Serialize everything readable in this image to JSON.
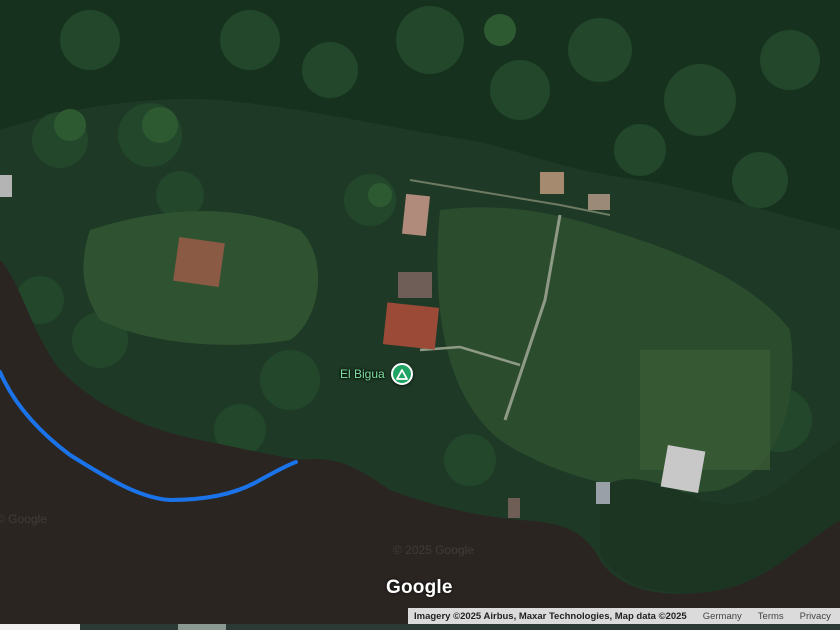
{
  "map": {
    "type": "satellite",
    "place": {
      "name": "El Bigua",
      "icon": "campground-pin-icon",
      "pin_color": "#1fa463"
    },
    "route_color": "#1a73e8",
    "water_color": "#2b2522"
  },
  "branding": {
    "logo_text": "Google",
    "watermark_text": "© 2025 Google",
    "watermark_partial": "© Google"
  },
  "attribution": {
    "imagery": "Imagery ©2025 Airbus, Maxar Technologies, Map data ©2025",
    "country": "Germany",
    "terms": "Terms",
    "privacy": "Privacy"
  }
}
